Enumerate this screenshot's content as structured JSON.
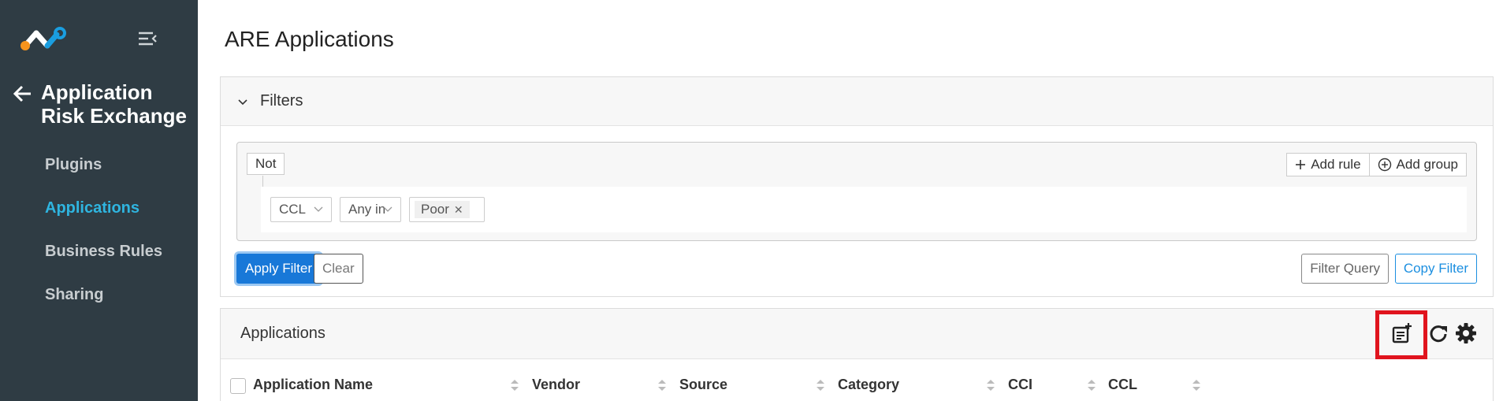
{
  "sidebar": {
    "back_label": "Application Risk Exchange",
    "nav": [
      {
        "label": "Plugins",
        "active": false
      },
      {
        "label": "Applications",
        "active": true
      },
      {
        "label": "Business Rules",
        "active": false
      },
      {
        "label": "Sharing",
        "active": false
      }
    ],
    "active_color": "#2fb5e0",
    "background_color": "#2f3c44"
  },
  "page": {
    "title": "ARE Applications"
  },
  "filters": {
    "title": "Filters",
    "not_label": "Not",
    "add_rule_label": "Add rule",
    "add_group_label": "Add group",
    "rule": {
      "field": "CCL",
      "operator": "Any in",
      "value_chip": "Poor"
    },
    "apply_label": "Apply Filter",
    "clear_label": "Clear",
    "filter_query_label": "Filter Query",
    "copy_filter_label": "Copy Filter"
  },
  "applications": {
    "title": "Applications",
    "toolbar_icons": [
      "add-note-icon",
      "refresh-icon",
      "gear-icon"
    ],
    "columns": [
      "Application Name",
      "Vendor",
      "Source",
      "Category",
      "CCI",
      "CCL"
    ]
  },
  "colors": {
    "primary": "#1878d8",
    "link": "#1c8fe0",
    "highlight": "#e0141e"
  }
}
